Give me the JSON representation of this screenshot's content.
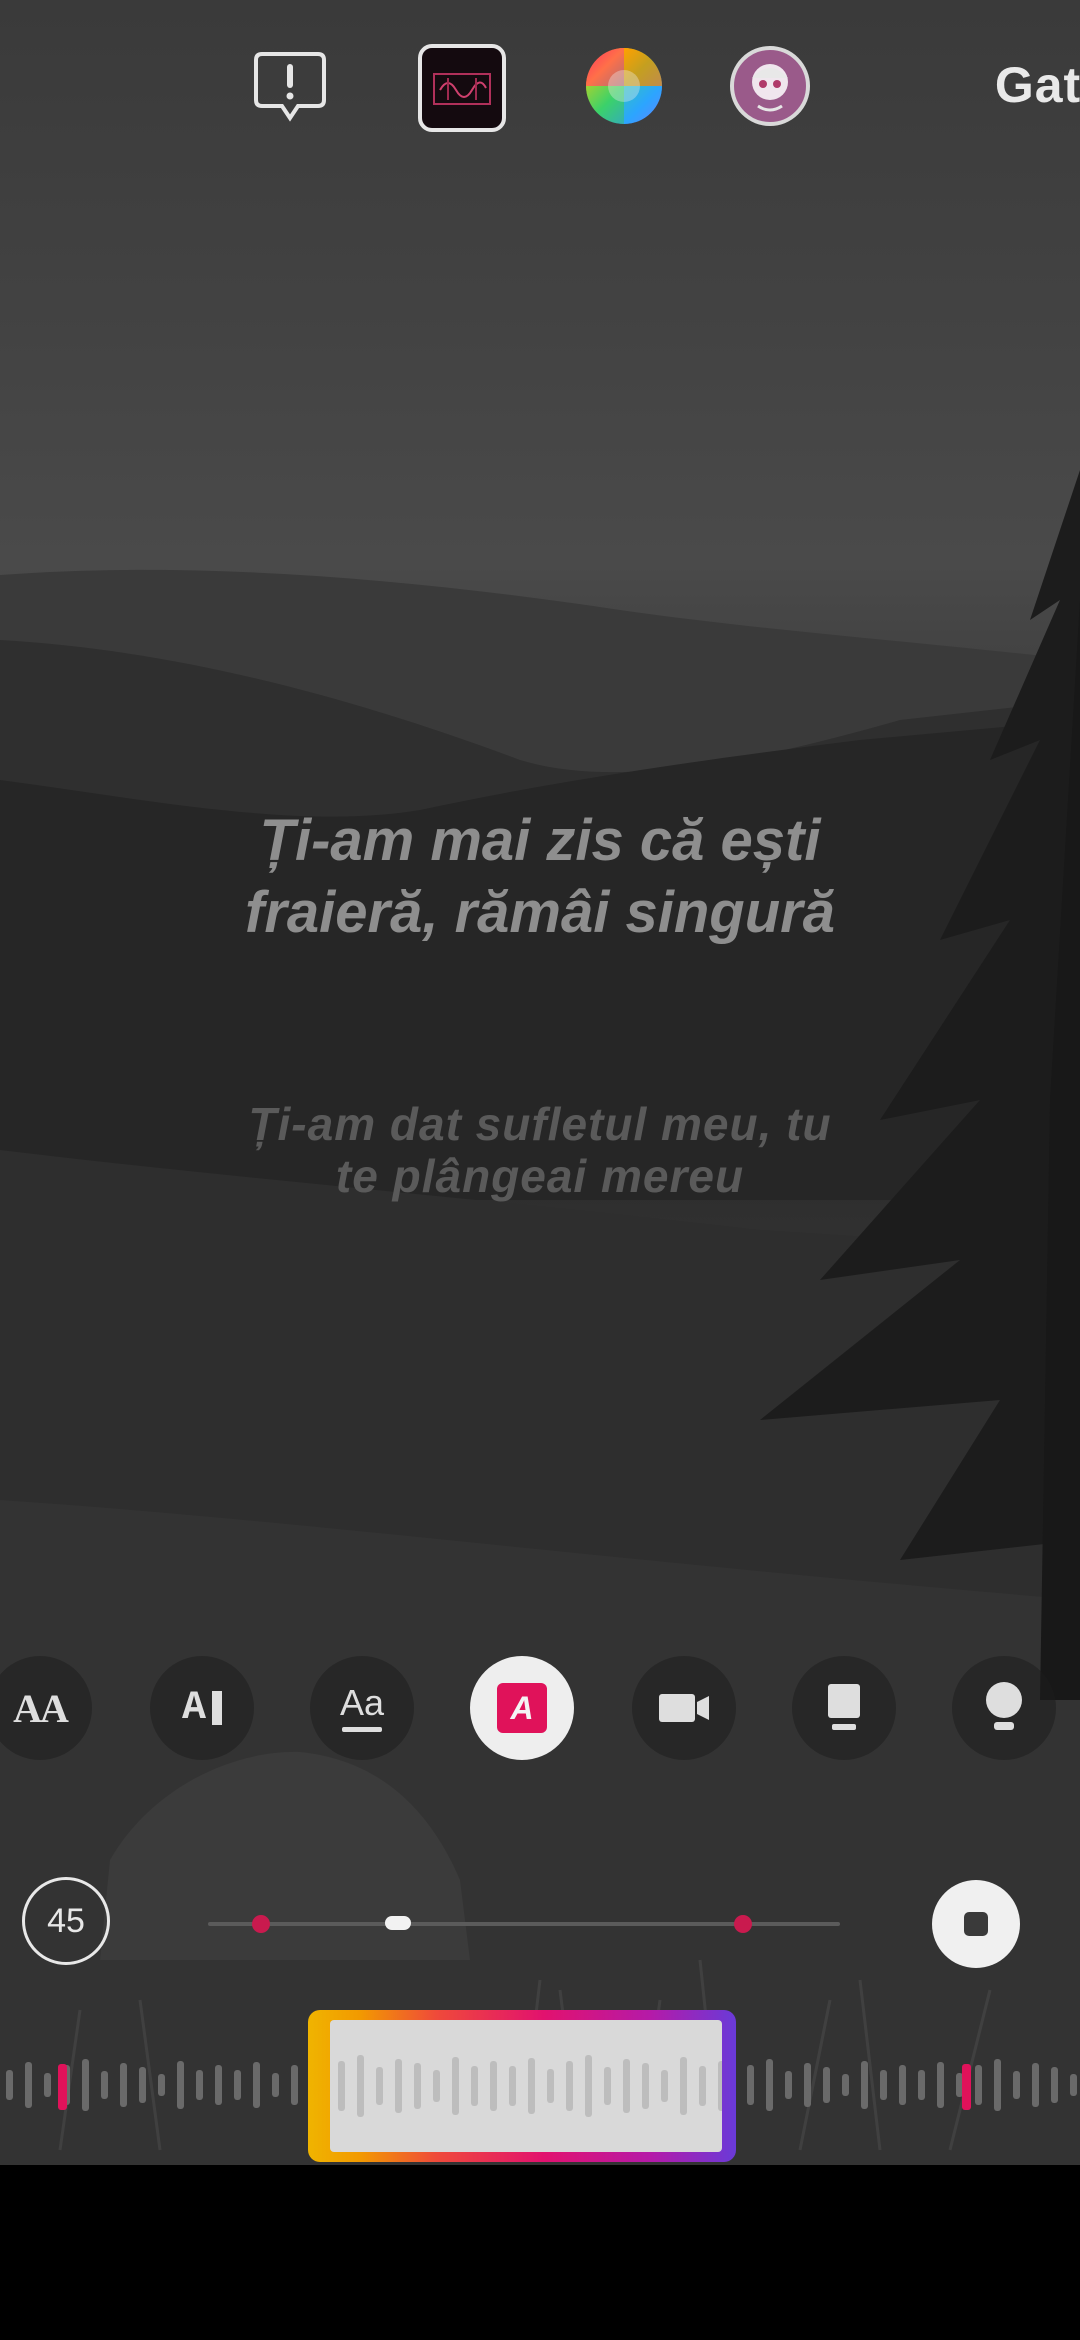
{
  "top_bar": {
    "alert_icon": "alert-bubble-icon",
    "sticker_icon": "lyrics-sticker-thumbnail",
    "color_icon": "color-wheel-icon",
    "effect_icon": "face-effect-icon",
    "done_label": "Gata"
  },
  "lyrics": {
    "current_line_1": "Ți-am mai zis că ești",
    "current_line_2": "fraieră, rămâi singură",
    "next_line_1": "Ți-am dat sufletul meu, tu",
    "next_line_2": "te plângeai mereu"
  },
  "style_toolbar": {
    "items": [
      {
        "name": "font-size-style",
        "label": "AA"
      },
      {
        "name": "typewriter-style",
        "label": "A"
      },
      {
        "name": "underline-style",
        "label": "Aa"
      },
      {
        "name": "highlight-style",
        "label": "A",
        "active": true
      },
      {
        "name": "video-clip-style",
        "label": ""
      },
      {
        "name": "card-style",
        "label": ""
      },
      {
        "name": "bulb-style",
        "label": ""
      }
    ]
  },
  "timeline": {
    "duration_seconds": "45",
    "playback_position": 0.3,
    "stop_icon": "stop-icon"
  },
  "colors": {
    "accent_pink": "#c91a4e",
    "highlight_active": "#e0125a",
    "selection_gradient_start": "#f0b400",
    "selection_gradient_end": "#6a3ad8"
  }
}
